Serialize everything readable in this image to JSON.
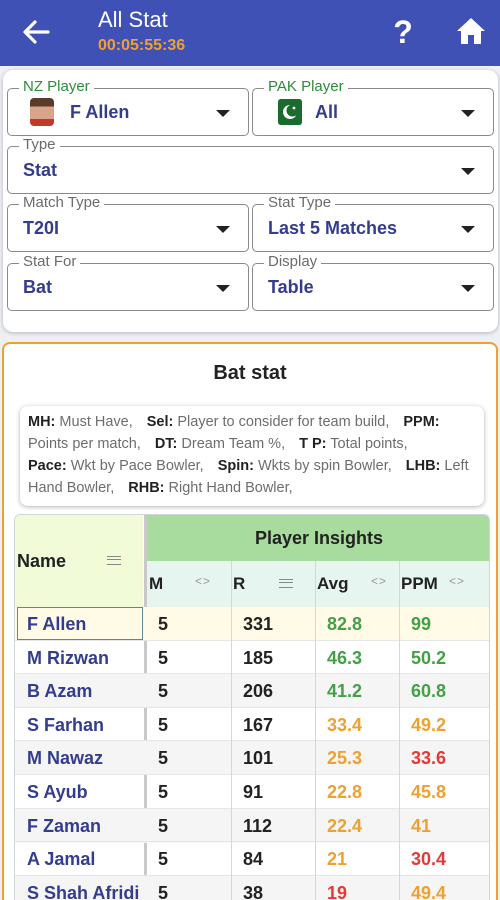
{
  "header": {
    "title": "All Stat",
    "timer": "00:05:55:36",
    "help_label": "?"
  },
  "filters": {
    "nz_player": {
      "label": "NZ Player",
      "value": "F Allen"
    },
    "pak_player": {
      "label": "PAK Player",
      "value": "All"
    },
    "type": {
      "label": "Type",
      "value": "Stat"
    },
    "match_type": {
      "label": "Match Type",
      "value": "T20I"
    },
    "stat_type": {
      "label": "Stat Type",
      "value": "Last 5 Matches"
    },
    "stat_for": {
      "label": "Stat For",
      "value": "Bat"
    },
    "display": {
      "label": "Display",
      "value": "Table"
    }
  },
  "stat": {
    "title": "Bat stat",
    "legend": [
      {
        "key": "MH:",
        "desc": "Must Have,"
      },
      {
        "key": "Sel:",
        "desc": "Player to consider for team build,"
      },
      {
        "key": "PPM:",
        "desc": "Points per match,"
      },
      {
        "key": "DT:",
        "desc": "Dream Team %,"
      },
      {
        "key": "T P:",
        "desc": "Total points,"
      },
      {
        "key": "Pace:",
        "desc": "Wkt by Pace Bowler,"
      },
      {
        "key": "Spin:",
        "desc": "Wkts by spin Bowler,"
      },
      {
        "key": "LHB:",
        "desc": "Left Hand Bowler,"
      },
      {
        "key": "RHB:",
        "desc": "Right Hand Bowler,"
      }
    ]
  },
  "table": {
    "name_header": "Name",
    "group_header": "Player Insights",
    "columns": [
      "M",
      "R",
      "Avg",
      "PPM"
    ],
    "rows": [
      {
        "name": "F Allen",
        "m": "5",
        "r": "331",
        "avg": "82.8",
        "ppm": "99",
        "avg_color": "good",
        "ppm_color": "good"
      },
      {
        "name": "M Rizwan",
        "m": "5",
        "r": "185",
        "avg": "46.3",
        "ppm": "50.2",
        "avg_color": "good",
        "ppm_color": "good"
      },
      {
        "name": "B Azam",
        "m": "5",
        "r": "206",
        "avg": "41.2",
        "ppm": "60.8",
        "avg_color": "good",
        "ppm_color": "good"
      },
      {
        "name": "S Farhan",
        "m": "5",
        "r": "167",
        "avg": "33.4",
        "ppm": "49.2",
        "avg_color": "mid",
        "ppm_color": "mid"
      },
      {
        "name": "M Nawaz",
        "m": "5",
        "r": "101",
        "avg": "25.3",
        "ppm": "33.6",
        "avg_color": "mid",
        "ppm_color": "bad"
      },
      {
        "name": "S Ayub",
        "m": "5",
        "r": "91",
        "avg": "22.8",
        "ppm": "45.8",
        "avg_color": "mid",
        "ppm_color": "mid"
      },
      {
        "name": "F Zaman",
        "m": "5",
        "r": "112",
        "avg": "22.4",
        "ppm": "41",
        "avg_color": "mid",
        "ppm_color": "mid"
      },
      {
        "name": "A Jamal",
        "m": "5",
        "r": "84",
        "avg": "21",
        "ppm": "30.4",
        "avg_color": "mid",
        "ppm_color": "bad"
      },
      {
        "name": "S Shah Afridi",
        "m": "5",
        "r": "38",
        "avg": "19",
        "ppm": "49.4",
        "avg_color": "bad",
        "ppm_color": "mid"
      }
    ]
  },
  "colors": {
    "appbar": "#3f51b5",
    "timer": "#f0a030",
    "good": "#43a047",
    "mid": "#f0a030",
    "bad": "#e53935",
    "card_border": "#f0a030"
  },
  "icons": [
    "back-arrow-icon",
    "help-icon",
    "home-icon",
    "player-avatar-icon",
    "pakistan-flag-icon",
    "dropdown-caret-icon",
    "column-menu-icon",
    "column-sort-icon"
  ]
}
